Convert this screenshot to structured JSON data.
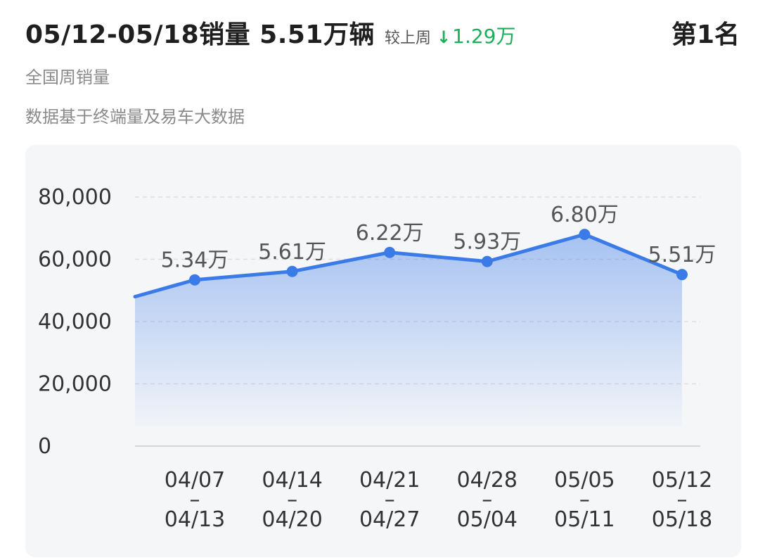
{
  "header": {
    "title": "05/12-05/18销量 5.51万辆",
    "compare_label": "较上周",
    "compare_arrow": "↓",
    "compare_value": "1.29万",
    "rank": "第1名"
  },
  "subtitle": "全国周销量",
  "source": "数据基于终端量及易车大数据",
  "colors": {
    "line": "#3b7be8",
    "decrease": "#1fae5b",
    "card_bg": "#f5f6f8"
  },
  "chart_data": {
    "type": "area",
    "categories": [
      [
        "04/07",
        "–",
        "04/13"
      ],
      [
        "04/14",
        "–",
        "04/20"
      ],
      [
        "04/21",
        "–",
        "04/27"
      ],
      [
        "04/28",
        "–",
        "05/04"
      ],
      [
        "05/05",
        "–",
        "05/11"
      ],
      [
        "05/12",
        "–",
        "05/18"
      ]
    ],
    "values": [
      53400,
      56100,
      62200,
      59300,
      68000,
      55100
    ],
    "data_labels": [
      "5.34万",
      "5.61万",
      "6.22万",
      "5.93万",
      "6.80万",
      "5.51万"
    ],
    "prior_value": 48000,
    "yticks": [
      0,
      20000,
      40000,
      60000,
      80000
    ],
    "ytick_labels": [
      "0",
      "20,000",
      "40,000",
      "60,000",
      "80,000"
    ],
    "ylim": [
      0,
      80000
    ],
    "grid": true,
    "legend": "none"
  }
}
